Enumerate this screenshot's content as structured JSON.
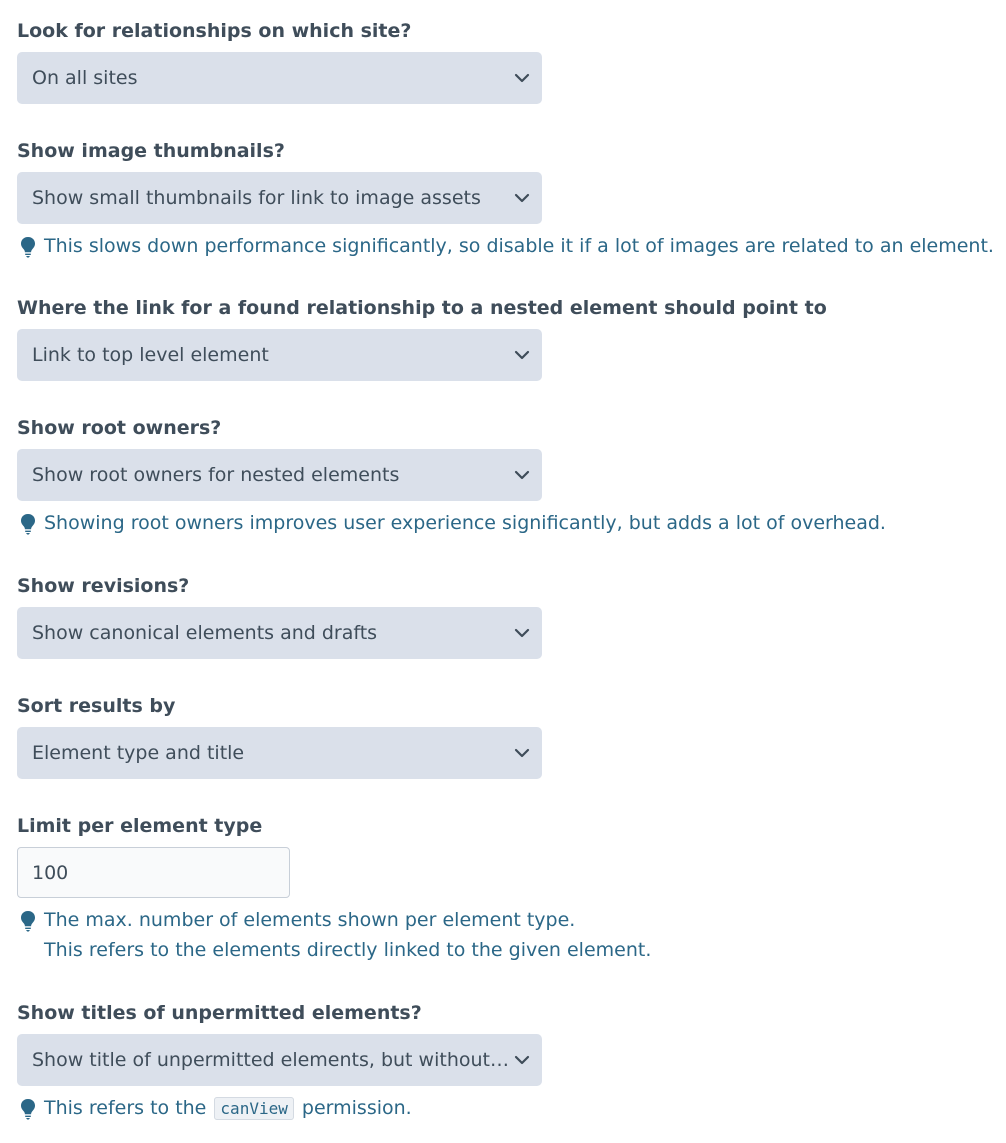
{
  "fields": [
    {
      "label": "Look for relationships on which site?",
      "value": "On all sites"
    },
    {
      "label": "Show image thumbnails?",
      "value": "Show small thumbnails for link to image assets",
      "tip": "This slows down performance significantly, so disable it if a lot of images are related to an element."
    },
    {
      "label": "Where the link for a found relationship to a nested element should point to",
      "value": "Link to top level element"
    },
    {
      "label": "Show root owners?",
      "value": "Show root owners for nested elements",
      "tip": "Showing root owners improves user experience significantly, but adds a lot of overhead."
    },
    {
      "label": "Show revisions?",
      "value": "Show canonical elements and drafts"
    },
    {
      "label": "Sort results by",
      "value": "Element type and title"
    },
    {
      "label": "Limit per element type",
      "value": "100",
      "tip_line1": "The max. number of elements shown per element type.",
      "tip_line2": "This refers to the elements directly linked to the given element."
    },
    {
      "label": "Show titles of unpermitted elements?",
      "value": "Show title of unpermitted elements, but without …",
      "tip_pre": "This refers to the",
      "tip_code": "canView",
      "tip_post": "permission."
    }
  ],
  "colors": {
    "select_bg": "#dae0ea",
    "tip_text": "#2b6787",
    "label_text": "#3f4d5a"
  },
  "icons": {
    "select_arrow": "chevron-down-icon",
    "tip": "lightbulb-icon"
  }
}
